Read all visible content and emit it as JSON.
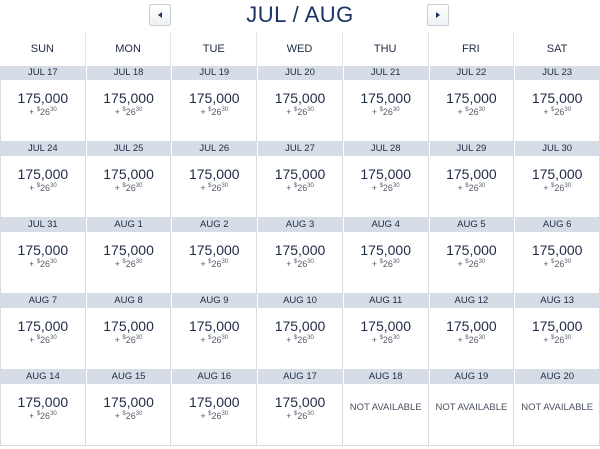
{
  "header": {
    "title": "JUL / AUG",
    "prev_icon": "chevron-left-icon",
    "next_icon": "chevron-right-icon"
  },
  "days_of_week": [
    "SUN",
    "MON",
    "TUE",
    "WED",
    "THU",
    "FRI",
    "SAT"
  ],
  "weeks": [
    [
      {
        "date": "JUL 17",
        "price": "175,000",
        "fee_prefix": "+ ",
        "fee_dollar": "$",
        "fee_int": "26",
        "fee_cents": "30"
      },
      {
        "date": "JUL 18",
        "price": "175,000",
        "fee_prefix": "+ ",
        "fee_dollar": "$",
        "fee_int": "26",
        "fee_cents": "30"
      },
      {
        "date": "JUL 19",
        "price": "175,000",
        "fee_prefix": "+ ",
        "fee_dollar": "$",
        "fee_int": "26",
        "fee_cents": "30"
      },
      {
        "date": "JUL 20",
        "price": "175,000",
        "fee_prefix": "+ ",
        "fee_dollar": "$",
        "fee_int": "26",
        "fee_cents": "30"
      },
      {
        "date": "JUL 21",
        "price": "175,000",
        "fee_prefix": "+ ",
        "fee_dollar": "$",
        "fee_int": "26",
        "fee_cents": "30"
      },
      {
        "date": "JUL 22",
        "price": "175,000",
        "fee_prefix": "+ ",
        "fee_dollar": "$",
        "fee_int": "26",
        "fee_cents": "30"
      },
      {
        "date": "JUL 23",
        "price": "175,000",
        "fee_prefix": "+ ",
        "fee_dollar": "$",
        "fee_int": "26",
        "fee_cents": "30"
      }
    ],
    [
      {
        "date": "JUL 24",
        "price": "175,000",
        "fee_prefix": "+ ",
        "fee_dollar": "$",
        "fee_int": "26",
        "fee_cents": "30"
      },
      {
        "date": "JUL 25",
        "price": "175,000",
        "fee_prefix": "+ ",
        "fee_dollar": "$",
        "fee_int": "26",
        "fee_cents": "30"
      },
      {
        "date": "JUL 26",
        "price": "175,000",
        "fee_prefix": "+ ",
        "fee_dollar": "$",
        "fee_int": "26",
        "fee_cents": "30"
      },
      {
        "date": "JUL 27",
        "price": "175,000",
        "fee_prefix": "+ ",
        "fee_dollar": "$",
        "fee_int": "26",
        "fee_cents": "30"
      },
      {
        "date": "JUL 28",
        "price": "175,000",
        "fee_prefix": "+ ",
        "fee_dollar": "$",
        "fee_int": "26",
        "fee_cents": "30"
      },
      {
        "date": "JUL 29",
        "price": "175,000",
        "fee_prefix": "+ ",
        "fee_dollar": "$",
        "fee_int": "26",
        "fee_cents": "30"
      },
      {
        "date": "JUL 30",
        "price": "175,000",
        "fee_prefix": "+ ",
        "fee_dollar": "$",
        "fee_int": "26",
        "fee_cents": "30"
      }
    ],
    [
      {
        "date": "JUL 31",
        "price": "175,000",
        "fee_prefix": "+ ",
        "fee_dollar": "$",
        "fee_int": "26",
        "fee_cents": "30"
      },
      {
        "date": "AUG 1",
        "price": "175,000",
        "fee_prefix": "+ ",
        "fee_dollar": "$",
        "fee_int": "26",
        "fee_cents": "30"
      },
      {
        "date": "AUG 2",
        "price": "175,000",
        "fee_prefix": "+ ",
        "fee_dollar": "$",
        "fee_int": "26",
        "fee_cents": "30"
      },
      {
        "date": "AUG 3",
        "price": "175,000",
        "fee_prefix": "+ ",
        "fee_dollar": "$",
        "fee_int": "26",
        "fee_cents": "30"
      },
      {
        "date": "AUG 4",
        "price": "175,000",
        "fee_prefix": "+ ",
        "fee_dollar": "$",
        "fee_int": "26",
        "fee_cents": "30"
      },
      {
        "date": "AUG 5",
        "price": "175,000",
        "fee_prefix": "+ ",
        "fee_dollar": "$",
        "fee_int": "26",
        "fee_cents": "30"
      },
      {
        "date": "AUG 6",
        "price": "175,000",
        "fee_prefix": "+ ",
        "fee_dollar": "$",
        "fee_int": "26",
        "fee_cents": "30"
      }
    ],
    [
      {
        "date": "AUG 7",
        "price": "175,000",
        "fee_prefix": "+ ",
        "fee_dollar": "$",
        "fee_int": "26",
        "fee_cents": "30"
      },
      {
        "date": "AUG 8",
        "price": "175,000",
        "fee_prefix": "+ ",
        "fee_dollar": "$",
        "fee_int": "26",
        "fee_cents": "30"
      },
      {
        "date": "AUG 9",
        "price": "175,000",
        "fee_prefix": "+ ",
        "fee_dollar": "$",
        "fee_int": "26",
        "fee_cents": "30"
      },
      {
        "date": "AUG 10",
        "price": "175,000",
        "fee_prefix": "+ ",
        "fee_dollar": "$",
        "fee_int": "26",
        "fee_cents": "30"
      },
      {
        "date": "AUG 11",
        "price": "175,000",
        "fee_prefix": "+ ",
        "fee_dollar": "$",
        "fee_int": "26",
        "fee_cents": "30"
      },
      {
        "date": "AUG 12",
        "price": "175,000",
        "fee_prefix": "+ ",
        "fee_dollar": "$",
        "fee_int": "26",
        "fee_cents": "30"
      },
      {
        "date": "AUG 13",
        "price": "175,000",
        "fee_prefix": "+ ",
        "fee_dollar": "$",
        "fee_int": "26",
        "fee_cents": "30"
      }
    ],
    [
      {
        "date": "AUG 14",
        "price": "175,000",
        "fee_prefix": "+ ",
        "fee_dollar": "$",
        "fee_int": "26",
        "fee_cents": "30"
      },
      {
        "date": "AUG 15",
        "price": "175,000",
        "fee_prefix": "+ ",
        "fee_dollar": "$",
        "fee_int": "26",
        "fee_cents": "30"
      },
      {
        "date": "AUG 16",
        "price": "175,000",
        "fee_prefix": "+ ",
        "fee_dollar": "$",
        "fee_int": "26",
        "fee_cents": "30"
      },
      {
        "date": "AUG 17",
        "price": "175,000",
        "fee_prefix": "+ ",
        "fee_dollar": "$",
        "fee_int": "26",
        "fee_cents": "30"
      },
      {
        "date": "AUG 18",
        "not_available": "NOT AVAILABLE"
      },
      {
        "date": "AUG 19",
        "not_available": "NOT AVAILABLE"
      },
      {
        "date": "AUG 20",
        "not_available": "NOT AVAILABLE"
      }
    ]
  ],
  "colors": {
    "title": "#1c3463",
    "date_bar": "#d6dde6",
    "text": "#1f2a44"
  }
}
